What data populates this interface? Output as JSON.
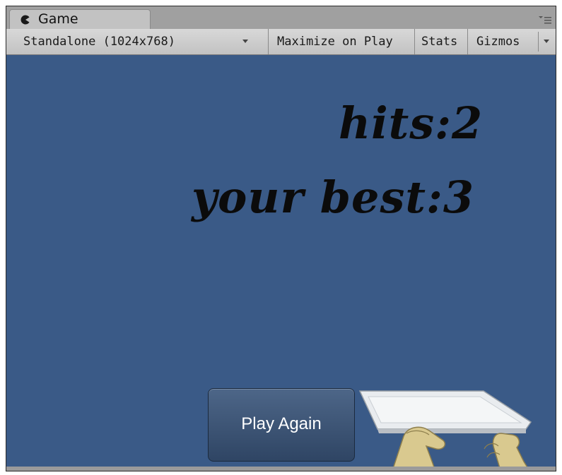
{
  "window": {
    "tab_title": "Game",
    "tab_icon": "pacman-icon",
    "panel_menu_icon": "panel-menu-icon"
  },
  "toolbar": {
    "aspect_label": "Standalone (1024x768)",
    "maximize_label": "Maximize on Play",
    "stats_label": "Stats",
    "gizmos_label": "Gizmos"
  },
  "game": {
    "hits_text": "hits:2",
    "best_text": "your best:3",
    "play_again_label": "Play Again"
  },
  "colors": {
    "viewport_background": "#3a5a87",
    "button_background": "#3b5274",
    "text_color": "#0b0b0b"
  }
}
